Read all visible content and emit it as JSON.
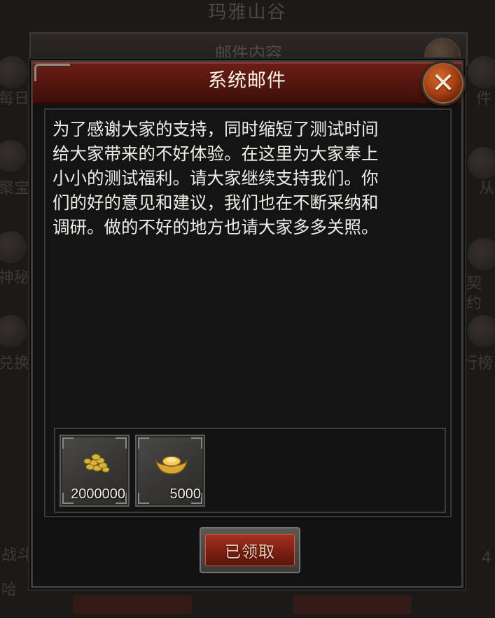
{
  "background": {
    "scene_title": "玛雅山谷",
    "panel_title": "邮件内容",
    "left_labels": [
      "每日",
      "聚宝",
      "神秘",
      "兑换"
    ],
    "right_labels": [
      "件",
      "从",
      "契约",
      "行榜"
    ],
    "bottom_left_label": "战斗",
    "bottom_left_label_2": "哈",
    "bottom_right_text": "4"
  },
  "dialog": {
    "title": "系统邮件",
    "message": "为了感谢大家的支持，同时缩短了测试时间\n给大家带来的不好体验。在这里为大家奉上\n小小的测试福利。请大家继续支持我们。你\n们的好的意见和建议，我们也在不断采纳和\n调研。做的不好的地方也请大家多多关照。",
    "attachments": [
      {
        "item": "gold-coins-icon",
        "quantity": "2000000"
      },
      {
        "item": "gold-ingot-icon",
        "quantity": "5000"
      }
    ],
    "claim_button": "已领取"
  },
  "colors": {
    "header": "#571710",
    "close_button": "#a84012",
    "claim_button": "#7d1f12",
    "panel_background": "#141414"
  }
}
